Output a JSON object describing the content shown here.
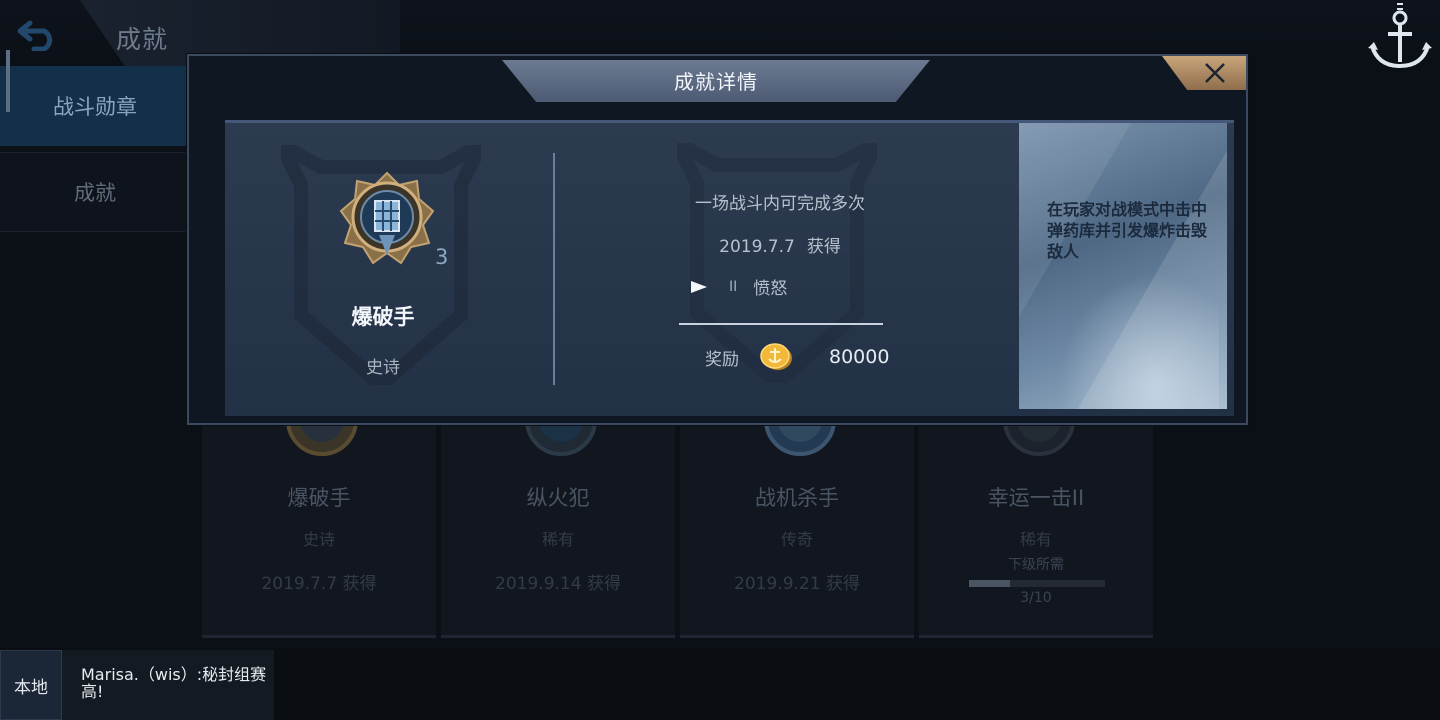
{
  "header": {
    "title": "成就",
    "back_icon": "back-arrow-icon",
    "anchor_icon": "anchor-icon"
  },
  "sidebar": {
    "items": [
      {
        "label": "战斗勋章",
        "active": true
      },
      {
        "label": "成就",
        "active": false
      }
    ]
  },
  "grid": {
    "cards": [
      {
        "name": "爆破手",
        "rarity": "史诗",
        "date": "2019.7.7  获得"
      },
      {
        "name": "纵火犯",
        "rarity": "稀有",
        "date": "2019.9.14 获得"
      },
      {
        "name": "战机杀手",
        "rarity": "传奇",
        "date": "2019.9.21 获得"
      },
      {
        "name": "幸运一击II",
        "rarity": "稀有",
        "next_label": "下级所需",
        "progress_text": "3/10",
        "progress": 0.3
      }
    ]
  },
  "modal": {
    "title": "成就详情",
    "close_icon": "close-icon",
    "achievement": {
      "count": "3",
      "name": "爆破手",
      "rarity": "史诗"
    },
    "details": {
      "description": "一场战斗内可完成多次",
      "date": "2019.7.7",
      "date_suffix": "获得",
      "level": "II",
      "level_name": "愤怒",
      "reward_label": "奖励",
      "reward_amount": "80000"
    },
    "hint": "在玩家对战模式中击中弹药库并引发爆炸击毁敌人"
  },
  "chat": {
    "channel": "本地",
    "message": "Marisa.（wis）:秘封组赛高!"
  },
  "colors": {
    "accent_gold": "#c9a57a",
    "active_tab": "#13304a"
  }
}
